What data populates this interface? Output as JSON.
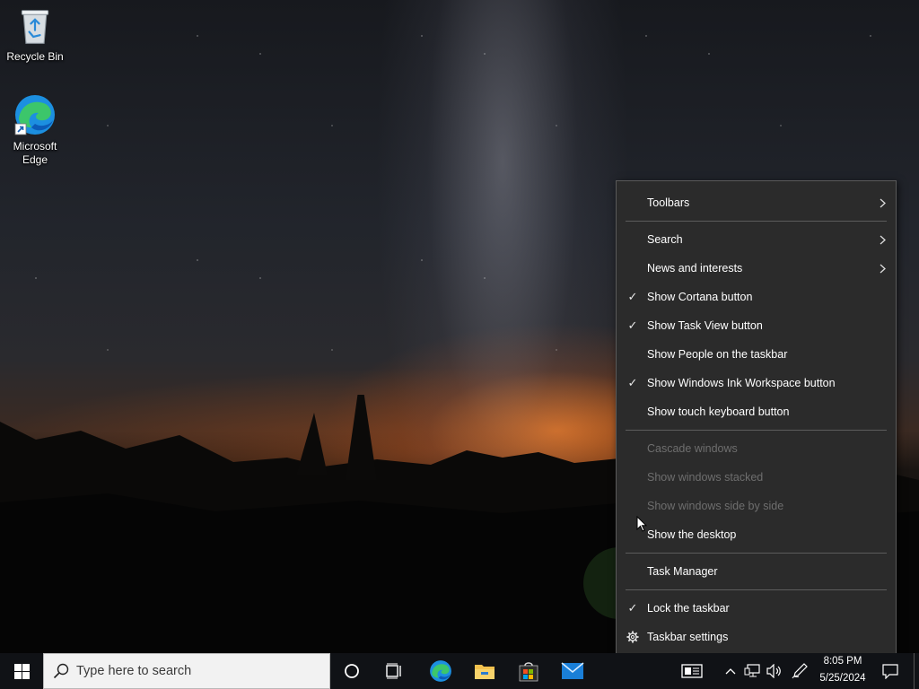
{
  "desktop": {
    "icons": [
      {
        "label": "Recycle Bin",
        "icon": "recycle-bin-icon"
      },
      {
        "label": "Microsoft Edge",
        "icon": "edge-icon"
      }
    ]
  },
  "context_menu": {
    "items": [
      {
        "label": "Toolbars",
        "submenu": true
      },
      {
        "label": "Search",
        "submenu": true
      },
      {
        "label": "News and interests",
        "submenu": true
      },
      {
        "label": "Show Cortana button",
        "checked": true
      },
      {
        "label": "Show Task View button",
        "checked": true
      },
      {
        "label": "Show People on the taskbar",
        "checked": false
      },
      {
        "label": "Show Windows Ink Workspace button",
        "checked": true
      },
      {
        "label": "Show touch keyboard button",
        "checked": false
      },
      {
        "label": "Cascade windows",
        "disabled": true
      },
      {
        "label": "Show windows stacked",
        "disabled": true
      },
      {
        "label": "Show windows side by side",
        "disabled": true
      },
      {
        "label": "Show the desktop"
      },
      {
        "label": "Task Manager"
      },
      {
        "label": "Lock the taskbar",
        "checked": true
      },
      {
        "label": "Taskbar settings",
        "icon": "gear-icon"
      }
    ],
    "check_glyph": "✓"
  },
  "taskbar": {
    "search_placeholder": "Type here to search",
    "time": "8:05 PM",
    "date": "5/25/2024",
    "pinned": [
      "edge-icon",
      "file-explorer-icon",
      "store-icon",
      "mail-icon"
    ]
  },
  "colors": {
    "menu_bg": "#2b2b2b",
    "taskbar_bg": "#101216",
    "edge_blue": "#1c8fe0",
    "edge_green": "#3cc66b",
    "folder_yellow": "#f2c14e",
    "mail_blue": "#1a7fd8"
  }
}
